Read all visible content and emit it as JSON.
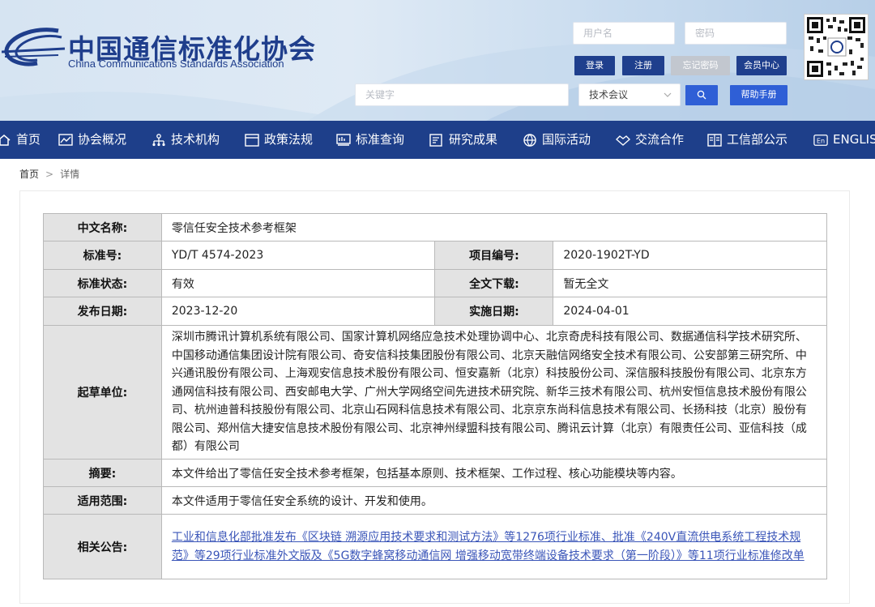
{
  "header": {
    "logo_cn": "中国通信标准化协会",
    "logo_en": "China Communications Standards Association",
    "username_placeholder": "用户名",
    "password_placeholder": "密码",
    "login_label": "登录",
    "register_label": "注册",
    "forgot_label": "忘记密码",
    "member_label": "会员中心",
    "keyword_placeholder": "关键字",
    "search_category": "技术会议",
    "help_label": "帮助手册"
  },
  "nav": [
    {
      "label": "首页",
      "icon": "home-icon"
    },
    {
      "label": "协会概况",
      "icon": "chart-icon"
    },
    {
      "label": "技术机构",
      "icon": "org-icon"
    },
    {
      "label": "政策法规",
      "icon": "window-icon"
    },
    {
      "label": "标准查询",
      "icon": "standard-icon"
    },
    {
      "label": "研究成果",
      "icon": "report-icon"
    },
    {
      "label": "国际活动",
      "icon": "globe-icon"
    },
    {
      "label": "交流合作",
      "icon": "handshake-icon"
    },
    {
      "label": "工信部公示",
      "icon": "notice-icon"
    },
    {
      "label": "ENGLISH",
      "icon": "en-icon"
    }
  ],
  "breadcrumb": {
    "home": "首页",
    "sep": ">",
    "current": "详情"
  },
  "detail": {
    "cn_name_label": "中文名称:",
    "cn_name": "零信任安全技术参考框架",
    "std_no_label": "标准号:",
    "std_no": "YD/T 4574-2023",
    "project_no_label": "项目编号:",
    "project_no": "2020-1902T-YD",
    "status_label": "标准状态:",
    "status": "有效",
    "download_label": "全文下载:",
    "download": "暂无全文",
    "publish_label": "发布日期:",
    "publish_date": "2023-12-20",
    "implement_label": "实施日期:",
    "implement_date": "2024-04-01",
    "drafters_label": "起草单位:",
    "drafters": "深圳市腾讯计算机系统有限公司、国家计算机网络应急技术处理协调中心、北京奇虎科技有限公司、数据通信科学技术研究所、中国移动通信集团设计院有限公司、奇安信科技集团股份有限公司、北京天融信网络安全技术有限公司、公安部第三研究所、中兴通讯股份有限公司、上海观安信息技术股份有限公司、恒安嘉新（北京）科技股份公司、深信服科技股份有限公司、北京东方通网信科技有限公司、西安邮电大学、广州大学网络空间先进技术研究院、新华三技术有限公司、杭州安恒信息技术股份有限公司、杭州迪普科技股份有限公司、北京山石网科信息技术有限公司、北京京东尚科信息技术有限公司、长扬科技（北京）股份有限公司、郑州信大捷安信息技术股份有限公司、北京神州绿盟科技有限公司、腾讯云计算（北京）有限责任公司、亚信科技（成都）有限公司",
    "abstract_label": "摘要:",
    "abstract": "本文件给出了零信任安全技术参考框架，包括基本原则、技术框架、工作过程、核心功能模块等内容。",
    "scope_label": "适用范围:",
    "scope": "本文件适用于零信任安全系统的设计、开发和使用。",
    "notice_label": "相关公告:",
    "notice": "工业和信息化部批准发布《区块链 溯源应用技术要求和测试方法》等1276项行业标准、批准《240V直流供电系统工程技术规范》等29项行业标准外文版及《5G数字蜂窝移动通信网 增强移动宽带终端设备技术要求（第一阶段）》等11项行业标准修改单"
  },
  "colors": {
    "nav_bg": "#1e3f8a",
    "brand": "#1f3e8c",
    "label_bg": "#e3e3e3",
    "link": "#3a55b8"
  }
}
